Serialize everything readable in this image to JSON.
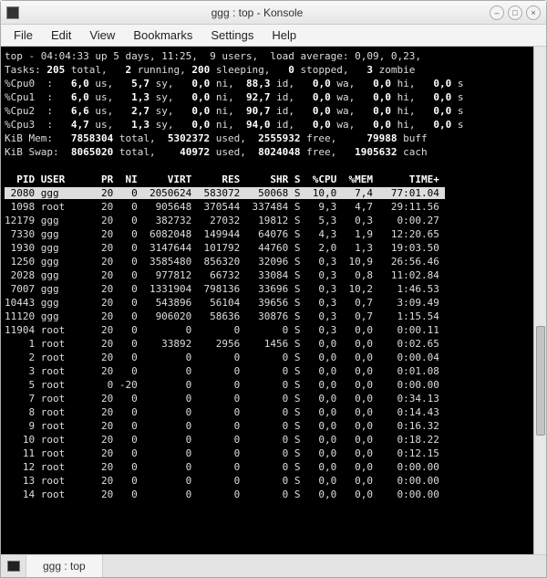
{
  "window": {
    "title": "ggg : top - Konsole"
  },
  "menu": {
    "file": "File",
    "edit": "Edit",
    "view": "View",
    "bookmarks": "Bookmarks",
    "settings": "Settings",
    "help": "Help"
  },
  "top": {
    "line1_a": "top - 04:04:33 up 5 days, 11:25,  9 users,  load average: 0,09, 0,23,",
    "tasks_label": "Tasks:",
    "tasks_total": "205",
    "tasks_total_lbl": " total,   ",
    "tasks_running": "2",
    "tasks_running_lbl": " running, ",
    "tasks_sleeping": "200",
    "tasks_sleeping_lbl": " sleeping,   ",
    "tasks_stopped": "0",
    "tasks_stopped_lbl": " stopped,   ",
    "tasks_zombie": "3",
    "tasks_zombie_lbl": " zombie",
    "cpu": [
      {
        "label": "%Cpu0  :",
        "us": "6,0",
        "sy": "5,7",
        "ni": "0,0",
        "id": "88,3",
        "wa": "0,0",
        "hi": "0,0",
        "si": "0,0"
      },
      {
        "label": "%Cpu1  :",
        "us": "6,0",
        "sy": "1,3",
        "ni": "0,0",
        "id": "92,7",
        "wa": "0,0",
        "hi": "0,0",
        "si": "0,0"
      },
      {
        "label": "%Cpu2  :",
        "us": "6,6",
        "sy": "2,7",
        "ni": "0,0",
        "id": "90,7",
        "wa": "0,0",
        "hi": "0,0",
        "si": "0,0"
      },
      {
        "label": "%Cpu3  :",
        "us": "4,7",
        "sy": "1,3",
        "ni": "0,0",
        "id": "94,0",
        "wa": "0,0",
        "hi": "0,0",
        "si": "0,0"
      }
    ],
    "mem": {
      "label": "KiB Mem:",
      "total": "7858304",
      "used": "5302372",
      "free": "2555932",
      "buff": "79988"
    },
    "swap": {
      "label": "KiB Swap:",
      "total": "8065020",
      "used": "40972",
      "free": "8024048",
      "cach": "1905632"
    }
  },
  "columns": {
    "pid": "PID",
    "user": "USER",
    "pr": "PR",
    "ni": "NI",
    "virt": "VIRT",
    "res": "RES",
    "shr": "SHR",
    "s": "S",
    "cpu": "%CPU",
    "mem": "%MEM",
    "time": "TIME+"
  },
  "processes": [
    {
      "pid": "2080",
      "user": "ggg",
      "pr": "20",
      "ni": "0",
      "virt": "2050624",
      "res": "583072",
      "shr": "50068",
      "s": "S",
      "cpu": "10,0",
      "mem": "7,4",
      "time": "77:01.04"
    },
    {
      "pid": "1098",
      "user": "root",
      "pr": "20",
      "ni": "0",
      "virt": "905648",
      "res": "370544",
      "shr": "337484",
      "s": "S",
      "cpu": "9,3",
      "mem": "4,7",
      "time": "29:11.56"
    },
    {
      "pid": "12179",
      "user": "ggg",
      "pr": "20",
      "ni": "0",
      "virt": "382732",
      "res": "27032",
      "shr": "19812",
      "s": "S",
      "cpu": "5,3",
      "mem": "0,3",
      "time": "0:00.27"
    },
    {
      "pid": "7330",
      "user": "ggg",
      "pr": "20",
      "ni": "0",
      "virt": "6082048",
      "res": "149944",
      "shr": "64076",
      "s": "S",
      "cpu": "4,3",
      "mem": "1,9",
      "time": "12:20.65"
    },
    {
      "pid": "1930",
      "user": "ggg",
      "pr": "20",
      "ni": "0",
      "virt": "3147644",
      "res": "101792",
      "shr": "44760",
      "s": "S",
      "cpu": "2,0",
      "mem": "1,3",
      "time": "19:03.50"
    },
    {
      "pid": "1250",
      "user": "ggg",
      "pr": "20",
      "ni": "0",
      "virt": "3585480",
      "res": "856320",
      "shr": "32096",
      "s": "S",
      "cpu": "0,3",
      "mem": "10,9",
      "time": "26:56.46"
    },
    {
      "pid": "2028",
      "user": "ggg",
      "pr": "20",
      "ni": "0",
      "virt": "977812",
      "res": "66732",
      "shr": "33084",
      "s": "S",
      "cpu": "0,3",
      "mem": "0,8",
      "time": "11:02.84"
    },
    {
      "pid": "7007",
      "user": "ggg",
      "pr": "20",
      "ni": "0",
      "virt": "1331904",
      "res": "798136",
      "shr": "33696",
      "s": "S",
      "cpu": "0,3",
      "mem": "10,2",
      "time": "1:46.53"
    },
    {
      "pid": "10443",
      "user": "ggg",
      "pr": "20",
      "ni": "0",
      "virt": "543896",
      "res": "56104",
      "shr": "39656",
      "s": "S",
      "cpu": "0,3",
      "mem": "0,7",
      "time": "3:09.49"
    },
    {
      "pid": "11120",
      "user": "ggg",
      "pr": "20",
      "ni": "0",
      "virt": "906020",
      "res": "58636",
      "shr": "30876",
      "s": "S",
      "cpu": "0,3",
      "mem": "0,7",
      "time": "1:15.54"
    },
    {
      "pid": "11904",
      "user": "root",
      "pr": "20",
      "ni": "0",
      "virt": "0",
      "res": "0",
      "shr": "0",
      "s": "S",
      "cpu": "0,3",
      "mem": "0,0",
      "time": "0:00.11"
    },
    {
      "pid": "1",
      "user": "root",
      "pr": "20",
      "ni": "0",
      "virt": "33892",
      "res": "2956",
      "shr": "1456",
      "s": "S",
      "cpu": "0,0",
      "mem": "0,0",
      "time": "0:02.65"
    },
    {
      "pid": "2",
      "user": "root",
      "pr": "20",
      "ni": "0",
      "virt": "0",
      "res": "0",
      "shr": "0",
      "s": "S",
      "cpu": "0,0",
      "mem": "0,0",
      "time": "0:00.04"
    },
    {
      "pid": "3",
      "user": "root",
      "pr": "20",
      "ni": "0",
      "virt": "0",
      "res": "0",
      "shr": "0",
      "s": "S",
      "cpu": "0,0",
      "mem": "0,0",
      "time": "0:01.08"
    },
    {
      "pid": "5",
      "user": "root",
      "pr": "0",
      "ni": "-20",
      "virt": "0",
      "res": "0",
      "shr": "0",
      "s": "S",
      "cpu": "0,0",
      "mem": "0,0",
      "time": "0:00.00"
    },
    {
      "pid": "7",
      "user": "root",
      "pr": "20",
      "ni": "0",
      "virt": "0",
      "res": "0",
      "shr": "0",
      "s": "S",
      "cpu": "0,0",
      "mem": "0,0",
      "time": "0:34.13"
    },
    {
      "pid": "8",
      "user": "root",
      "pr": "20",
      "ni": "0",
      "virt": "0",
      "res": "0",
      "shr": "0",
      "s": "S",
      "cpu": "0,0",
      "mem": "0,0",
      "time": "0:14.43"
    },
    {
      "pid": "9",
      "user": "root",
      "pr": "20",
      "ni": "0",
      "virt": "0",
      "res": "0",
      "shr": "0",
      "s": "S",
      "cpu": "0,0",
      "mem": "0,0",
      "time": "0:16.32"
    },
    {
      "pid": "10",
      "user": "root",
      "pr": "20",
      "ni": "0",
      "virt": "0",
      "res": "0",
      "shr": "0",
      "s": "S",
      "cpu": "0,0",
      "mem": "0,0",
      "time": "0:18.22"
    },
    {
      "pid": "11",
      "user": "root",
      "pr": "20",
      "ni": "0",
      "virt": "0",
      "res": "0",
      "shr": "0",
      "s": "S",
      "cpu": "0,0",
      "mem": "0,0",
      "time": "0:12.15"
    },
    {
      "pid": "12",
      "user": "root",
      "pr": "20",
      "ni": "0",
      "virt": "0",
      "res": "0",
      "shr": "0",
      "s": "S",
      "cpu": "0,0",
      "mem": "0,0",
      "time": "0:00.00"
    },
    {
      "pid": "13",
      "user": "root",
      "pr": "20",
      "ni": "0",
      "virt": "0",
      "res": "0",
      "shr": "0",
      "s": "S",
      "cpu": "0,0",
      "mem": "0,0",
      "time": "0:00.00"
    },
    {
      "pid": "14",
      "user": "root",
      "pr": "20",
      "ni": "0",
      "virt": "0",
      "res": "0",
      "shr": "0",
      "s": "S",
      "cpu": "0,0",
      "mem": "0,0",
      "time": "0:00.00"
    }
  ],
  "tab": {
    "label": "ggg : top"
  },
  "win_controls": {
    "min": "–",
    "max": "□",
    "close": "×"
  }
}
